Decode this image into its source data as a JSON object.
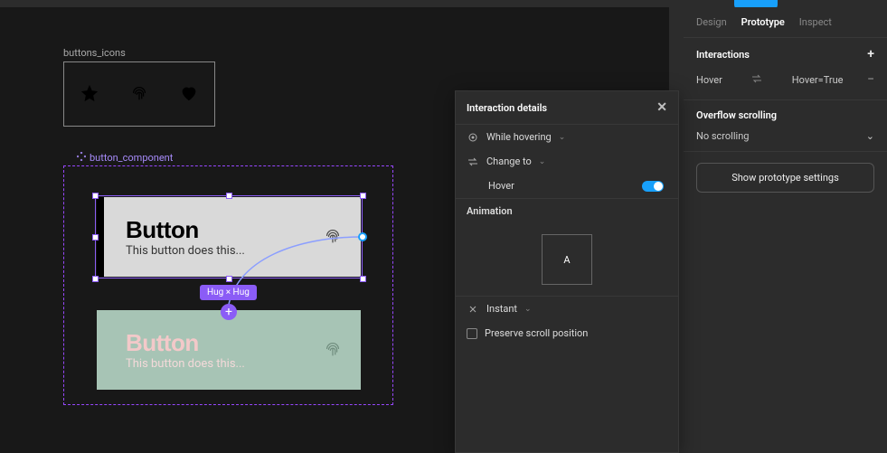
{
  "topbar": {},
  "canvas": {
    "icons_frame_label": "buttons_icons",
    "component_label": "button_component",
    "variant1": {
      "title": "Button",
      "subtitle": "This button does this..."
    },
    "variant2": {
      "title": "Button",
      "subtitle": "This button does this..."
    },
    "constraint_badge": "Hug × Hug"
  },
  "popup": {
    "title": "Interaction details",
    "trigger_label": "While hovering",
    "action_label": "Change to",
    "property_label": "Hover",
    "property_toggle_on": true,
    "animation_section": "Animation",
    "animation_preview_letter": "A",
    "easing_label": "Instant",
    "preserve_scroll_label": "Preserve scroll position"
  },
  "sidebar": {
    "tabs": {
      "design": "Design",
      "prototype": "Prototype",
      "inspect": "Inspect",
      "active": "prototype"
    },
    "interactions": {
      "title": "Interactions",
      "rows": [
        {
          "trigger": "Hover",
          "target": "Hover=True"
        }
      ]
    },
    "overflow": {
      "title": "Overflow scrolling",
      "value": "No scrolling"
    },
    "show_prototype_btn": "Show prototype settings"
  },
  "icons": {
    "star": "star-icon",
    "fingerprint": "fingerprint-icon",
    "heart": "heart-icon",
    "component": "component-icon",
    "plus": "plus-icon",
    "close": "close-icon",
    "chevron_down": "chevron-down-icon",
    "swap": "swap-icon",
    "minus": "minus-icon",
    "mouse": "mouse-hover-icon",
    "instant": "instant-icon",
    "checkbox": "checkbox-icon"
  }
}
